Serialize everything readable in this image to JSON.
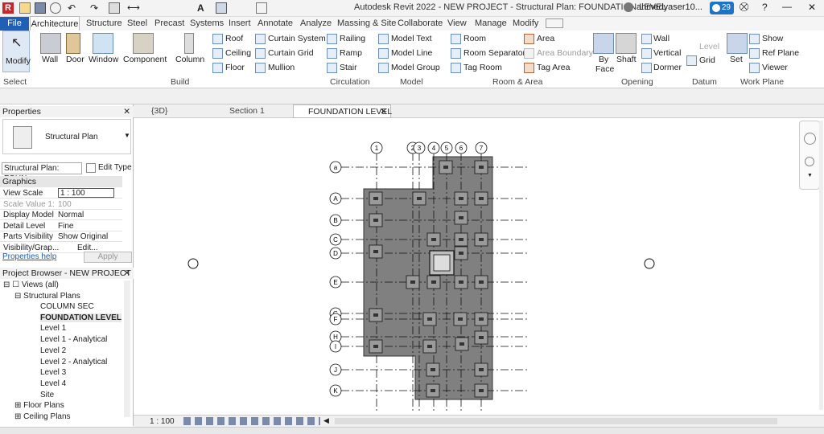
{
  "title": "Autodesk Revit 2022 - NEW PROJECT - Structural Plan: FOUNDATION LEVEL",
  "user": {
    "name": "ahmedyaser10...",
    "notifications": "29"
  },
  "tabs": [
    "File",
    "Architecture",
    "Structure",
    "Steel",
    "Precast",
    "Systems",
    "Insert",
    "Annotate",
    "Analyze",
    "Massing & Site",
    "Collaborate",
    "View",
    "Manage",
    "Modify"
  ],
  "active_tab": "Architecture",
  "ribbon": {
    "select": {
      "modify": "Modify",
      "group": "Select"
    },
    "build": {
      "wall": "Wall",
      "door": "Door",
      "window": "Window",
      "component": "Component",
      "column": "Column",
      "roof": "Roof",
      "ceiling": "Ceiling",
      "floor": "Floor",
      "curtain_system": "Curtain System",
      "curtain_grid": "Curtain Grid",
      "mullion": "Mullion",
      "group": "Build"
    },
    "circulation": {
      "railing": "Railing",
      "ramp": "Ramp",
      "stair": "Stair",
      "group": "Circulation"
    },
    "model": {
      "model_text": "Model Text",
      "model_line": "Model Line",
      "model_group": "Model Group",
      "group": "Model"
    },
    "room_area": {
      "room": "Room",
      "room_separator": "Room Separator",
      "tag_room": "Tag Room",
      "area": "Area",
      "area_boundary": "Area Boundary",
      "tag_area": "Tag Area",
      "group": "Room & Area"
    },
    "opening": {
      "by_face": "By",
      "by_face2": "Face",
      "shaft": "Shaft",
      "wall": "Wall",
      "vertical": "Vertical",
      "dormer": "Dormer",
      "group": "Opening"
    },
    "datum": {
      "level": "Level",
      "grid": "Grid",
      "group": "Datum"
    },
    "work_plane": {
      "set": "Set",
      "show": "Show",
      "ref_plane": "Ref Plane",
      "viewer": "Viewer",
      "group": "Work Plane"
    }
  },
  "properties": {
    "header": "Properties",
    "type_name": "Structural Plan",
    "instance_select": "Structural Plan: FOUN",
    "edit_type": "Edit Type",
    "section": "Graphics",
    "rows": [
      {
        "label": "View Scale",
        "value": "1 : 100"
      },
      {
        "label": "Scale Value    1:",
        "value": "100"
      },
      {
        "label": "Display Model",
        "value": "Normal"
      },
      {
        "label": "Detail Level",
        "value": "Fine"
      },
      {
        "label": "Parts Visibility",
        "value": "Show Original"
      },
      {
        "label": "Visibility/Grap...",
        "value": "Edit..."
      }
    ],
    "help": "Properties help",
    "apply": "Apply"
  },
  "browser": {
    "header": "Project Browser - NEW PROJECT",
    "views_all": "Views (all)",
    "structural_plans": "Structural Plans",
    "items": [
      "COLUMN SEC",
      "FOUNDATION LEVEL",
      "Level 1",
      "Level 1 - Analytical",
      "Level 2",
      "Level 2 - Analytical",
      "Level 3",
      "Level 4",
      "Site"
    ],
    "floor_plans": "Floor Plans",
    "ceiling_plans": "Ceiling Plans"
  },
  "view_tabs": [
    "{3D}",
    "Section 1",
    "FOUNDATION LEVEL"
  ],
  "status": {
    "scale": "1 : 100"
  },
  "grid_cols": [
    "1",
    "2",
    "3",
    "4",
    "5",
    "6",
    "7"
  ],
  "grid_rows": [
    "a",
    "A",
    "B",
    "C",
    "D",
    "E",
    "G",
    "F",
    "H",
    "I",
    "J",
    "K"
  ],
  "colors": {
    "file_tab": "#1f5fb6",
    "slab": "#808080",
    "accent": "#1e72c8"
  }
}
